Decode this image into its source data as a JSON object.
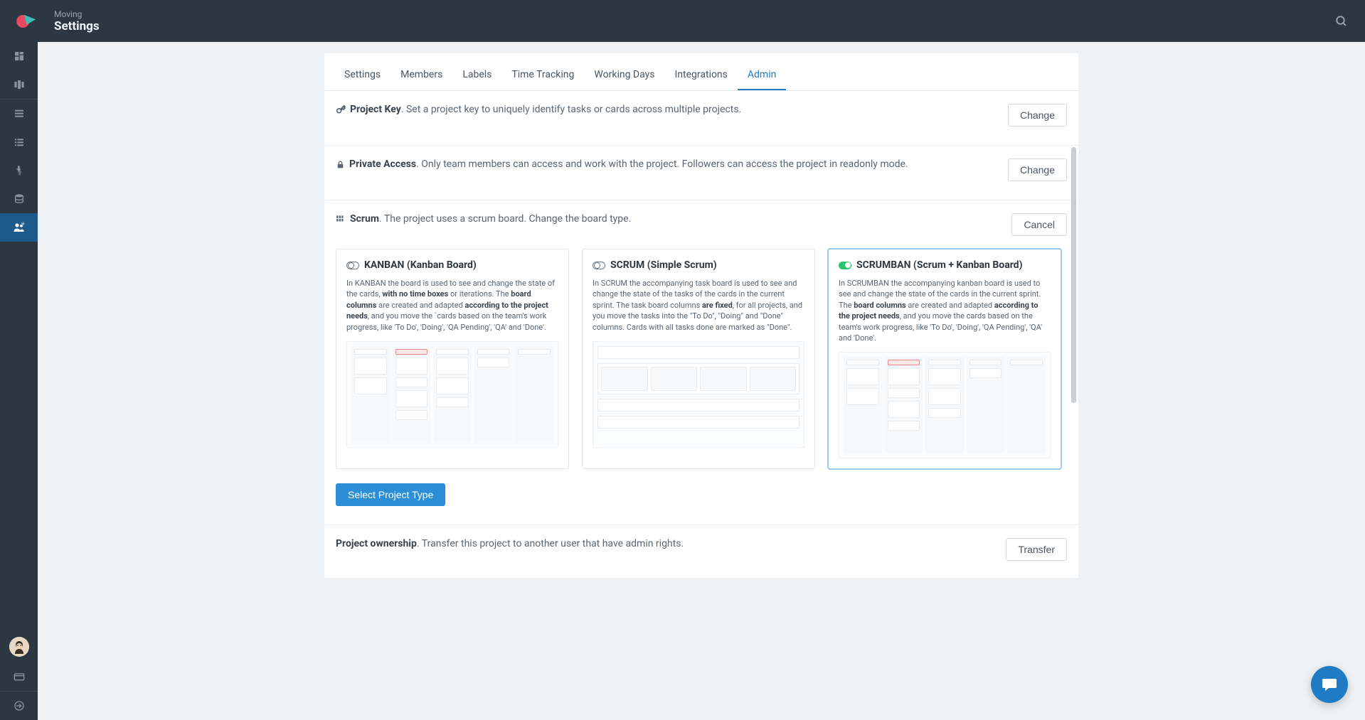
{
  "header": {
    "breadcrumb": "Moving",
    "title": "Settings"
  },
  "tabs": [
    {
      "label": "Settings"
    },
    {
      "label": "Members"
    },
    {
      "label": "Labels"
    },
    {
      "label": "Time Tracking"
    },
    {
      "label": "Working Days"
    },
    {
      "label": "Integrations"
    },
    {
      "label": "Admin",
      "active": true
    }
  ],
  "sections": {
    "project_key": {
      "title": "Project Key",
      "desc": ". Set a project key to uniquely identify tasks or cards across multiple projects.",
      "action": "Change"
    },
    "private_access": {
      "title": "Private Access",
      "desc": ". Only team members can access and work with the project. Followers can access the project in readonly mode.",
      "action": "Change"
    },
    "scrum": {
      "title": "Scrum",
      "desc": ". The project uses a scrum board. Change the board type.",
      "action": "Cancel"
    },
    "ownership": {
      "title": "Project ownership",
      "desc": ". Transfer this project to another user that have admin rights.",
      "action": "Transfer"
    }
  },
  "boards": {
    "kanban": {
      "title": "KANBAN (Kanban Board)",
      "text_parts": [
        "In KANBAN the board is used to see and change the state of the cards, ",
        "with no time boxes",
        " or iterations. The ",
        "board columns",
        " are created and adapted ",
        "according to the project needs",
        ", and you move the `cards based on the team's work progress, like 'To Do', 'Doing', 'QA Pending', 'QA' and 'Done'."
      ]
    },
    "scrum": {
      "title": "SCRUM (Simple Scrum)",
      "text_parts": [
        "In SCRUM the accompanying task board is used to see and change the state of the tasks of the cards in the current sprint. The task board columns ",
        "are fixed",
        ", for all projects, and you move the tasks into the \"To Do\", \"Doing\" and \"Done\" columns. Cards with all tasks done are marked as \"Done\"."
      ]
    },
    "scrumban": {
      "title": "SCRUMBAN (Scrum + Kanban Board)",
      "text_parts": [
        "In SCRUMBAN the accompanying kanban board is used to see and change the state of the cards in the current sprint. The ",
        "board columns",
        " are created and adapted ",
        "according to the project needs",
        ", and you move the cards based on the team's work progress, like 'To Do', 'Doing', 'QA Pending', 'QA' and 'Done'."
      ]
    }
  },
  "select_button": "Select Project Type"
}
